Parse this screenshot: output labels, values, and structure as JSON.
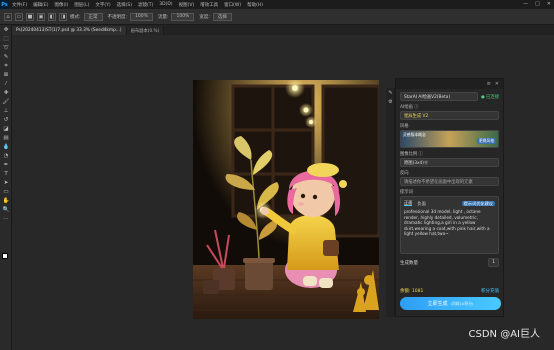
{
  "app": {
    "logo": "Ps"
  },
  "menu": [
    "文件(F)",
    "编辑(E)",
    "图像(I)",
    "图层(L)",
    "文字(Y)",
    "选择(S)",
    "滤镜(T)",
    "3D(D)",
    "视图(V)",
    "增效工具",
    "窗口(W)",
    "帮助(H)"
  ],
  "window_controls": [
    "—",
    "□",
    "✕"
  ],
  "options_bar": {
    "mode_label": "模式:",
    "mode_value": "正常",
    "opacity_label": "不透明度:",
    "opacity_value": "100%",
    "flow_label": "流量:",
    "flow_value": "100%",
    "width_label": "宽度:",
    "select_value": "选择"
  },
  "tabs": [
    {
      "label": "Ps(20240413)ST(1)7.psd @ 33.3% (Seed4kmp...)",
      "active": true
    },
    {
      "label": "画布副本(0.%)",
      "active": false
    }
  ],
  "panel": {
    "header_icons": [
      "≡",
      "✕"
    ],
    "model_select": "StarAI AI绘画V2(Beta)",
    "status_badge": "● 已连接",
    "ai_model_label": "AI绘画 ⓘ",
    "ai_model_value": "星辰生成 V2",
    "style_label": "风格",
    "style_name": "灵感版本概念",
    "style_btn": "更换风格",
    "size_label": "图像比例 ⓘ",
    "size_value": "原图(3x4)⓪",
    "direction_label": "反向",
    "direction_value": "请描述你不希望在画面中出现的元素",
    "prompt_label": "提示词",
    "prompt_tab1": "正面",
    "prompt_tab2": "负面",
    "prompt_btn": "提示词优化建议",
    "prompt_text": "professional 3d model, light , octane render, highly detailed, volumetric, dramatic lighting,a girl in a yellow skirt,wearing a coat,with pink hair,with a light yellow hat,two~",
    "count_label": "生成数量",
    "count_value": "1",
    "credit_text": "余额: 1081",
    "credit_link": "积分充值",
    "generate_label": "立即生成",
    "generate_sub": "(消耗10积分)"
  },
  "watermark": "CSDN @AI巨人",
  "colors": {
    "accent": "#31a8ff",
    "generate_gradient_start": "#2e9ef5",
    "generate_gradient_end": "#4ac9ff",
    "workspace": "#282828"
  }
}
